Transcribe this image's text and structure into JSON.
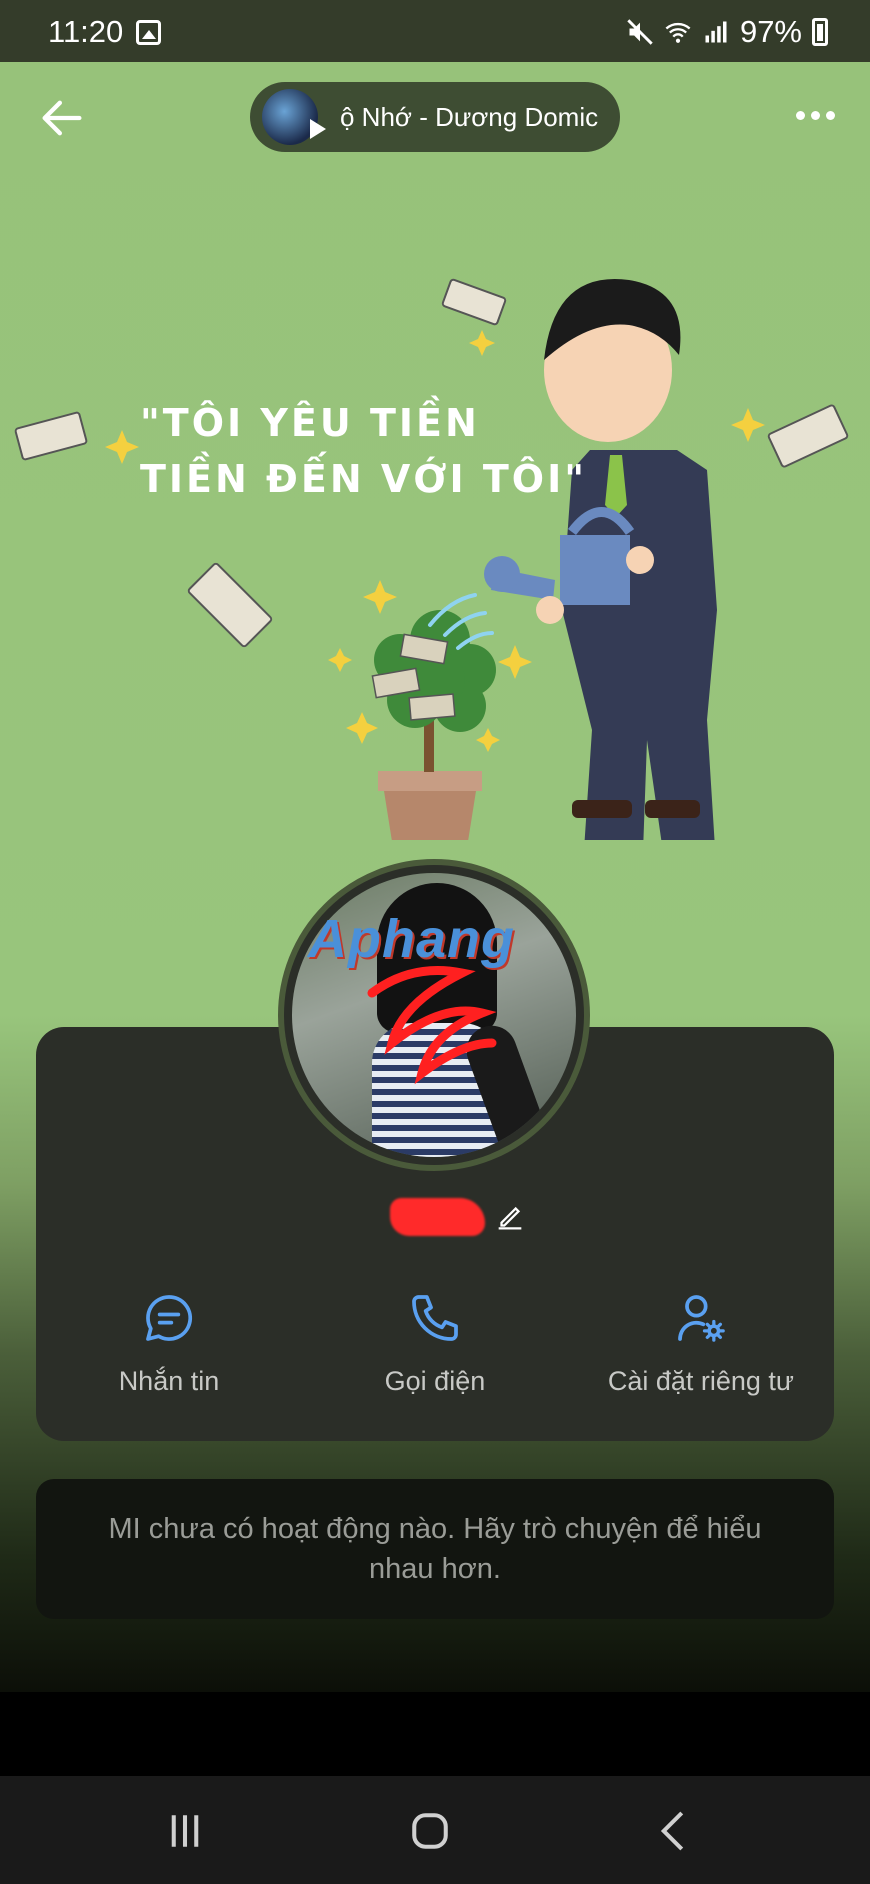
{
  "status_bar": {
    "time": "11:20",
    "battery": "97%",
    "icons": [
      "gallery-icon",
      "mute-icon",
      "wifi-icon",
      "signal-icon",
      "battery-icon"
    ]
  },
  "header": {
    "music_title": "ộ Nhớ - Dương Domic",
    "back_icon": "arrow-left-icon",
    "more_icon": "more-dots-icon"
  },
  "cover": {
    "quote_line1": "\"TÔI YÊU TIỀN",
    "quote_line2": "TIỀN ĐẾN VỚI TÔI\""
  },
  "profile": {
    "watermark": "Aphang",
    "name": ""
  },
  "actions": [
    {
      "label": "Nhắn tin",
      "icon": "chat-icon"
    },
    {
      "label": "Gọi điện",
      "icon": "phone-icon"
    },
    {
      "label": "Cài đặt riêng tư",
      "icon": "privacy-settings-icon"
    }
  ],
  "activity": {
    "empty_message": "MI chưa có hoạt động nào. Hãy trò chuyện để hiểu nhau hơn."
  },
  "colors": {
    "cover_background": "#97c27a",
    "card_background": "#2b2e28",
    "action_blue": "#5aa0f0"
  }
}
